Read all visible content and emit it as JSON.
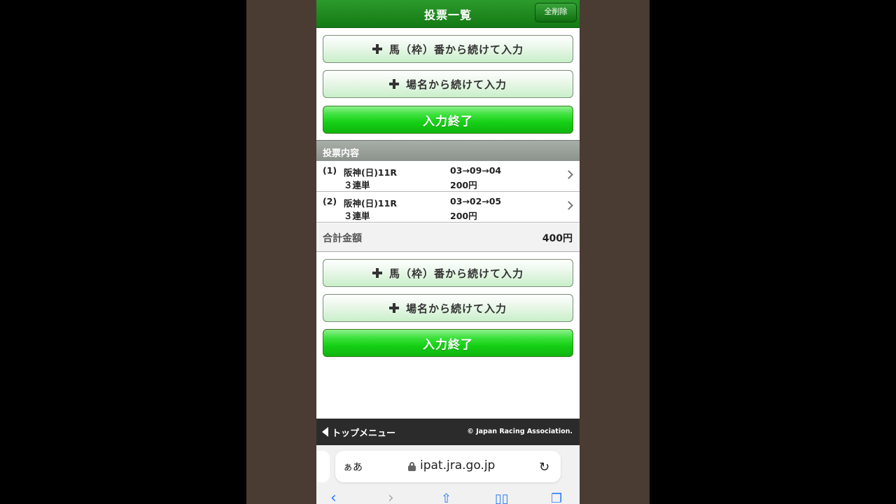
{
  "header": {
    "title": "投票一覧",
    "clear_all": "全削除"
  },
  "buttons": {
    "horse_number_entry": "馬（枠）番から続けて入力",
    "venue_entry": "場名から続けて入力",
    "finish_entry": "入力終了"
  },
  "section": {
    "title": "投票内容"
  },
  "bets": [
    {
      "num": "(1)",
      "race": "阪神(日)11R",
      "type": "３連単",
      "combo": "03→09→04",
      "amount": "200円"
    },
    {
      "num": "(2)",
      "race": "阪神(日)11R",
      "type": "３連単",
      "combo": "03→02→05",
      "amount": "200円"
    }
  ],
  "total": {
    "label": "合計金額",
    "value": "400円"
  },
  "footer": {
    "menu": "トップメニュー",
    "copyright": "© Japan Racing Association."
  },
  "browser": {
    "aa": "ぁあ",
    "url": "ipat.jra.go.jp"
  },
  "icons": [
    "plus-icon",
    "chevron-right-icon",
    "triangle-left-icon",
    "lock-icon",
    "reload-icon",
    "back-icon",
    "forward-icon",
    "share-icon",
    "bookmarks-icon",
    "tabs-icon"
  ],
  "colors": {
    "header_green": "#1f8a1f",
    "finish_green": "#22d022",
    "section_gray": "#9aa09a",
    "footer_dark": "#2b2b2b"
  }
}
